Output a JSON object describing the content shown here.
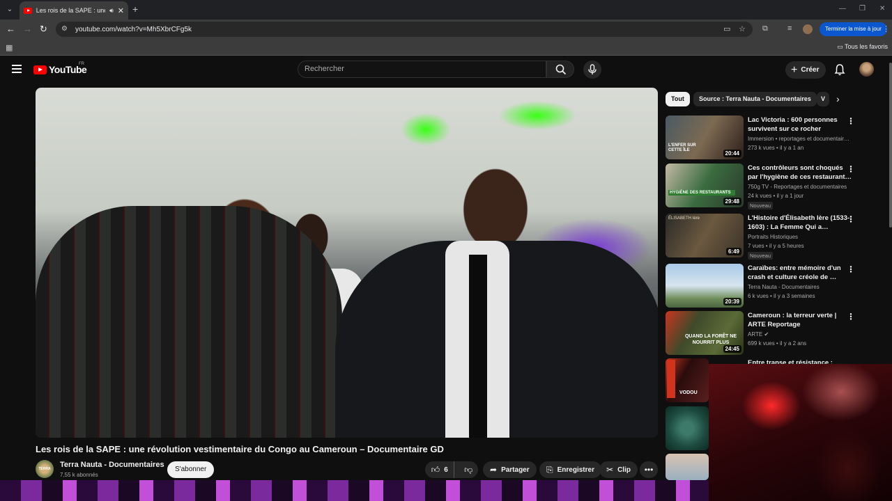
{
  "browser": {
    "tab_title": "Les rois de la SAPE : une révolution",
    "audio_icon": "speaker-icon",
    "url": "youtube.com/watch?v=Mh5XbrCFg5k",
    "update_button": "Terminer la mise à jour",
    "bookmarks_folder": "Tous les favoris",
    "colors": {
      "tabbar": "#202124",
      "toolbar": "#3c3c3c",
      "update": "#0b57d0"
    }
  },
  "header": {
    "logo": "YouTube",
    "country": "FR",
    "search_placeholder": "Rechercher",
    "create_label": "Créer"
  },
  "video": {
    "title": "Les rois de la SAPE : une révolution vestimentaire du Congo au Cameroun – Documentaire GD",
    "channel": "Terra Nauta - Documentaires",
    "channel_avatar_text": "TERRA NAUTA",
    "subscribers": "7,55 k abonnés",
    "subscribe_label": "S'abonner",
    "likes": "6",
    "share_label": "Partager",
    "save_label": "Enregistrer",
    "clip_label": "Clip"
  },
  "chips": [
    "Tout",
    "Source : Terra Nauta - Documentaires",
    "V"
  ],
  "recommendations": [
    {
      "title": "Lac Victoria : 600 personnes survivent sur ce rocher",
      "channel": "Immersion • reportages et documentair…",
      "meta": "273 k vues • il y a 1 an",
      "duration": "20:44",
      "thumb_text": "L'ENFER SUR CETTE ÎLE",
      "badge": ""
    },
    {
      "title": "Ces contrôleurs sont choqués par l'hygiène de ces restaurant…",
      "channel": "750g TV - Reportages et documentaires",
      "meta": "24 k vues • il y a 1 jour",
      "duration": "29:48",
      "thumb_text": "HYGIÈNE DES RESTAURANTS",
      "badge": "Nouveau"
    },
    {
      "title": "L'Histoire d'Élisabeth Ière (1533-1603) : La Femme Qui a…",
      "channel": "Portraits Historiques",
      "meta": "7 vues • il y a 5 heures",
      "duration": "6:49",
      "thumb_text": "ÉLISABETH Ière",
      "badge": "Nouveau"
    },
    {
      "title": "Caraïbes: entre mémoire d'un crash et culture créole de …",
      "channel": "Terra Nauta - Documentaires",
      "meta": "6 k vues • il y a 3 semaines",
      "duration": "20:39",
      "thumb_text": "",
      "badge": ""
    },
    {
      "title": "Cameroun : la terreur verte | ARTE Reportage",
      "channel": "ARTE",
      "meta": "699 k vues • il y a 2 ans",
      "duration": "24:45",
      "thumb_text": "QUAND LA FORÊT NE NOURRIT PLUS",
      "badge": ""
    },
    {
      "title": "Entre transe et résistance :",
      "channel": "",
      "meta": "",
      "duration": "",
      "thumb_text": "VODOU",
      "badge": ""
    }
  ]
}
